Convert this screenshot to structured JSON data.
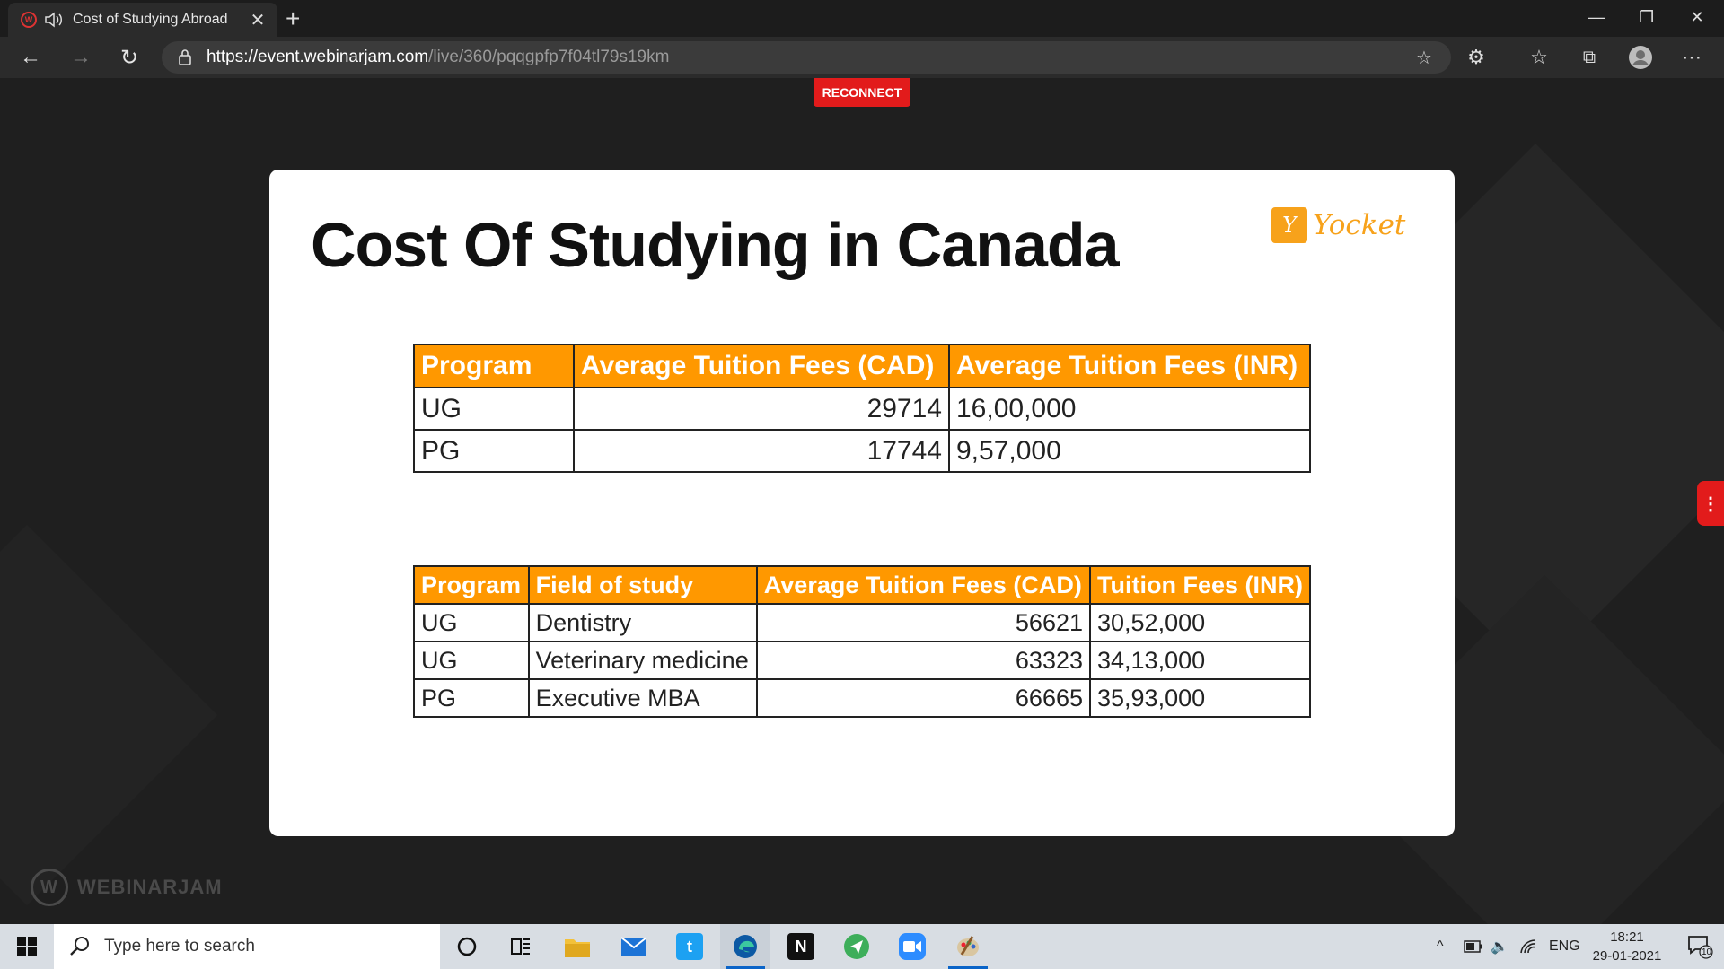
{
  "browser": {
    "tab_title": "Cost of Studying Abroad",
    "url_host": "https://event.webinarjam.com",
    "url_path": "/live/360/pqqgpfp7f04tl79s19km"
  },
  "page": {
    "reconnect_label": "RECONNECT",
    "brand_watermark": "WEBINARJAM"
  },
  "slide": {
    "title": "Cost Of Studying in Canada",
    "logo_text": "Yocket",
    "table1": {
      "headers": [
        "Program",
        "Average Tuition Fees (CAD)",
        "Average Tuition Fees (INR)"
      ],
      "rows": [
        [
          "UG",
          "29714",
          "16,00,000"
        ],
        [
          "PG",
          "17744",
          "9,57,000"
        ]
      ]
    },
    "table2": {
      "headers": [
        "Program",
        "Field of study",
        "Average Tuition Fees (CAD)",
        "Tuition Fees (INR)"
      ],
      "rows": [
        [
          "UG",
          "Dentistry",
          "56621",
          "30,52,000"
        ],
        [
          "UG",
          "Veterinary medicine",
          "63323",
          "34,13,000"
        ],
        [
          "PG",
          "Executive MBA",
          "66665",
          "35,93,000"
        ]
      ]
    }
  },
  "taskbar": {
    "search_placeholder": "Type here to search",
    "language": "ENG",
    "time": "18:21",
    "date": "29-01-2021",
    "notification_count": "10"
  },
  "colors": {
    "header_orange": "#ff9800",
    "reconnect_red": "#e21b1b",
    "yocket_orange": "#f7a21b"
  }
}
